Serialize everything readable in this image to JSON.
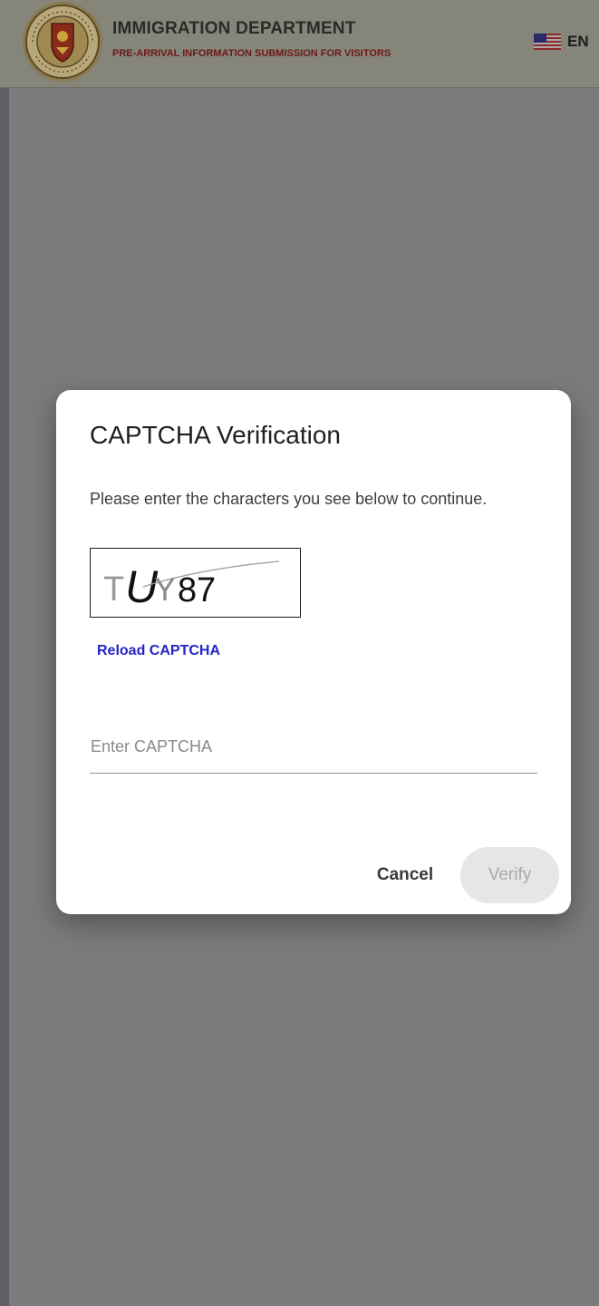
{
  "header": {
    "department_title": "IMMIGRATION DEPARTMENT",
    "department_subtitle": "PRE-ARRIVAL INFORMATION SUBMISSION FOR VISITORS",
    "language_code": "EN",
    "language_flag_icon": "us-flag-icon",
    "emblem_icon": "immigration-emblem-icon"
  },
  "dialog": {
    "title": "CAPTCHA Verification",
    "instruction": "Please enter the characters you see below to continue.",
    "captcha_characters": [
      "T",
      "U",
      "Y",
      "8",
      "7"
    ],
    "reload_label": "Reload CAPTCHA",
    "input_placeholder": "Enter CAPTCHA",
    "input_value": "",
    "cancel_label": "Cancel",
    "verify_label": "Verify",
    "verify_enabled": false
  },
  "colors": {
    "overlay": "#7a7b7d",
    "link": "#2424c8",
    "subtitle": "#6e1818",
    "verify_disabled_bg": "#e6e6e6",
    "verify_disabled_text": "#a9a9a9"
  }
}
